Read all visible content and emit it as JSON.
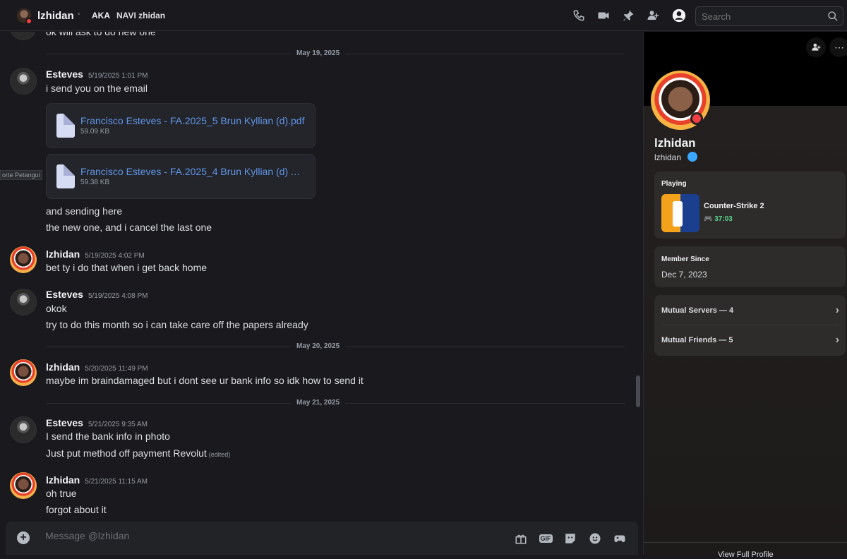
{
  "header": {
    "title": "lzhidan",
    "aka_label": "AKA",
    "nickname": "NAVI zhidan",
    "search_placeholder": "Search",
    "icons": [
      "phone-call-icon",
      "video-call-icon",
      "pin-icon",
      "add-friend-icon",
      "user-profile-icon",
      "search-icon"
    ]
  },
  "chat": {
    "partial_top": "ok will ask to do new one",
    "side_tag": "orte Petangui",
    "dividers": [
      "May 19, 2025",
      "May 20, 2025",
      "May 21, 2025"
    ],
    "messages": [
      {
        "author": "Esteves",
        "time": "5/19/2025 1:01 PM",
        "lines": [
          "i send you on the email"
        ]
      },
      {
        "author": "lzhidan",
        "time": "5/19/2025 4:02 PM",
        "lines": [
          "bet ty i do that when i get back home"
        ]
      },
      {
        "author": "Esteves",
        "time": "5/19/2025 4:08 PM",
        "lines": [
          "okok",
          "try to do this month so i can take care off the papers already"
        ]
      },
      {
        "author": "lzhidan",
        "time": "5/20/2025 11:49 PM",
        "lines": [
          "maybe im braindamaged but i dont see ur bank info so idk how to send it"
        ]
      },
      {
        "author": "Esteves",
        "time": "5/21/2025 9:35 AM",
        "lines": [
          "I send the bank info in photo",
          "Just put method off payment Revolut"
        ],
        "edited": "(edited)"
      },
      {
        "author": "lzhidan",
        "time": "5/21/2025 11:15 AM",
        "lines": [
          "oh true",
          "forgot about it"
        ]
      }
    ],
    "followups": [
      "and sending here",
      "the new one, and i cancel the last one"
    ],
    "attachments": [
      {
        "name": "Francisco Esteves - FA.2025_5 Brun Kyllian (d).pdf",
        "size": "59.09 KB"
      },
      {
        "name": "Francisco Esteves - FA.2025_4 Brun Kyllian (d) AN...",
        "size": "59.38 KB"
      }
    ]
  },
  "composer": {
    "placeholder": "Message @lzhidan",
    "icons": [
      "add-attachment-icon",
      "gift-icon",
      "gif-icon",
      "sticker-icon",
      "emoji-icon",
      "activity-icon"
    ],
    "gif_label": "GIF"
  },
  "profile": {
    "display_name": "lzhidan",
    "username": "lzhidan",
    "playing_header": "Playing",
    "game_name": "Counter-Strike 2",
    "game_time": "37:03",
    "member_since_header": "Member Since",
    "member_since": "Dec 7, 2023",
    "mutual_servers": "Mutual Servers — 4",
    "mutual_friends": "Mutual Friends — 5",
    "footer": "View Full Profile"
  },
  "colors": {
    "accent_link": "#5f95e8",
    "status_dnd": "#f23f43",
    "game_time": "#57d38c"
  }
}
